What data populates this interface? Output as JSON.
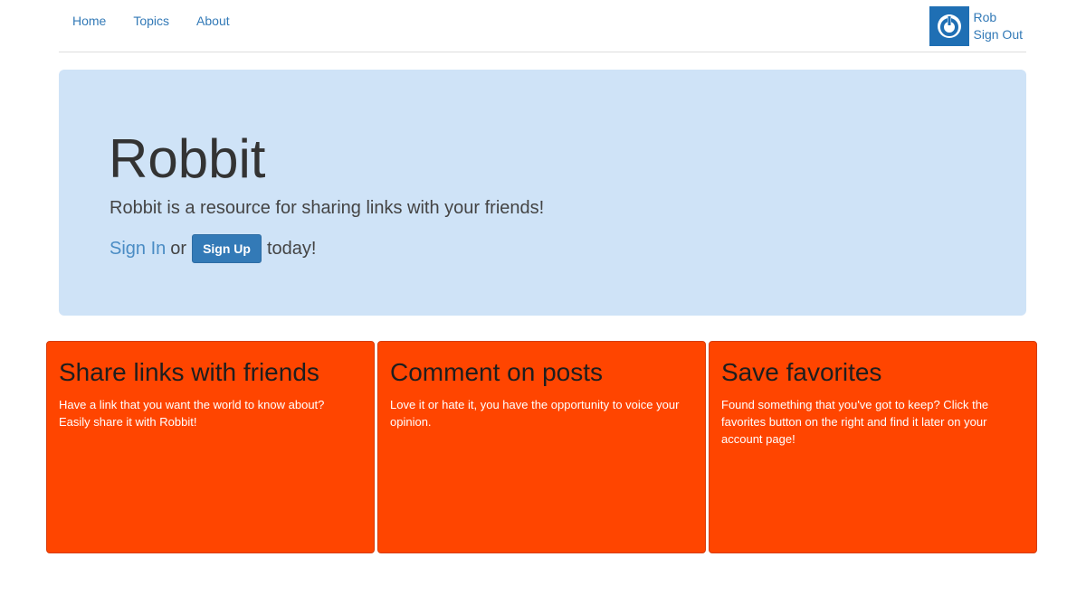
{
  "nav": {
    "links": [
      {
        "label": "Home"
      },
      {
        "label": "Topics"
      },
      {
        "label": "About"
      }
    ],
    "user": {
      "name": "Rob",
      "sign_out": "Sign Out",
      "avatar_icon": "power-icon",
      "avatar_color": "#1f6fb4"
    }
  },
  "hero": {
    "title": "Robbit",
    "lead": "Robbit is a resource for sharing links with your friends!",
    "signin_label": "Sign In",
    "or_text": "or",
    "signup_label": "Sign Up",
    "today_text": "today!",
    "background": "#cfe3f7"
  },
  "features": [
    {
      "title": "Share links with friends",
      "text": "Have a link that you want the world to know about? Easily share it with Robbit!"
    },
    {
      "title": "Comment on posts",
      "text": "Love it or hate it, you have the opportunity to voice your opinion."
    },
    {
      "title": "Save favorites",
      "text": "Found something that you've got to keep? Click the favorites button on the right and find it later on your account page!"
    }
  ],
  "colors": {
    "accent": "#337ab7",
    "card": "#ff4500"
  }
}
